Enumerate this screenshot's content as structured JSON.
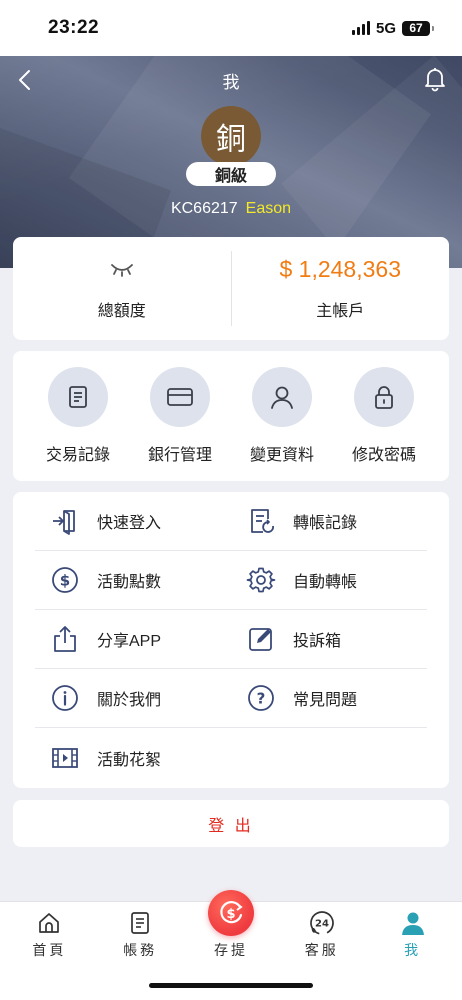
{
  "status_bar": {
    "time": "23:22",
    "network": "5G",
    "battery": "67"
  },
  "header": {
    "title": "我",
    "avatar_char": "銅",
    "level": "銅級",
    "user_id": "KC66217",
    "user_name": "Eason"
  },
  "balance": {
    "total_label": "總額度",
    "main_amount": "$ 1,248,363",
    "main_label": "主帳戶"
  },
  "quick_actions": [
    {
      "label": "交易記錄",
      "icon": "document-icon"
    },
    {
      "label": "銀行管理",
      "icon": "card-icon"
    },
    {
      "label": "變更資料",
      "icon": "user-icon"
    },
    {
      "label": "修改密碼",
      "icon": "lock-icon"
    }
  ],
  "menu": [
    {
      "label": "快速登入",
      "icon": "login-door-icon"
    },
    {
      "label": "轉帳記錄",
      "icon": "transfer-record-icon"
    },
    {
      "label": "活動點數",
      "icon": "dollar-circle-icon"
    },
    {
      "label": "自動轉帳",
      "icon": "gear-icon"
    },
    {
      "label": "分享APP",
      "icon": "share-icon"
    },
    {
      "label": "投訴箱",
      "icon": "edit-box-icon"
    },
    {
      "label": "關於我們",
      "icon": "info-icon"
    },
    {
      "label": "常見問題",
      "icon": "question-icon"
    },
    {
      "label": "活動花絮",
      "icon": "film-icon"
    }
  ],
  "logout_label": "登 出",
  "tabs": [
    {
      "label": "首頁",
      "icon": "home-icon"
    },
    {
      "label": "帳務",
      "icon": "ledger-icon"
    },
    {
      "label": "存提",
      "icon": "deposit-withdraw-icon"
    },
    {
      "label": "客服",
      "icon": "support-24h-icon"
    },
    {
      "label": "我",
      "icon": "profile-icon",
      "active": true
    }
  ],
  "colors": {
    "accent": "#2aa0b5",
    "amount": "#f07c13",
    "username": "#f3e928",
    "logout": "#e32a1f",
    "avatar": "#7a5a35",
    "center_button": "#ef3a3f"
  }
}
